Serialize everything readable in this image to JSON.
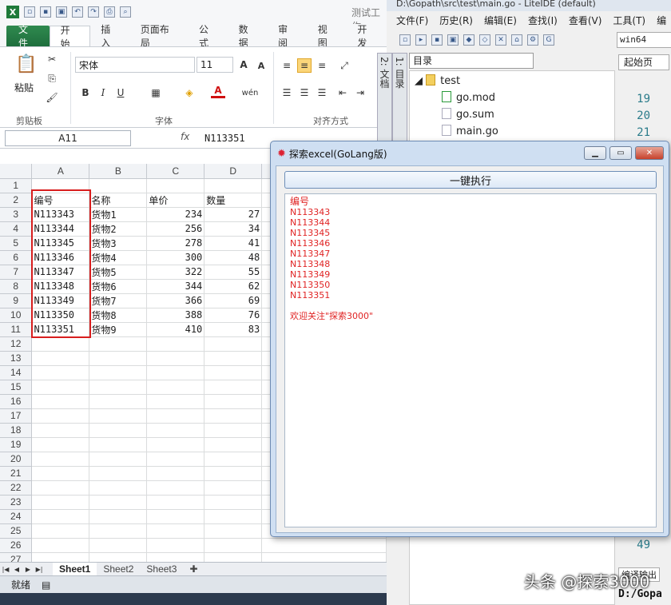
{
  "excel": {
    "workbook_title": "测试工作",
    "tabs": [
      "文件",
      "开始",
      "插入",
      "页面布局",
      "公式",
      "数据",
      "审阅",
      "视图",
      "开发"
    ],
    "ribbon": {
      "paste_label": "粘贴",
      "clipboard_label": "剪贴板",
      "font_name": "宋体",
      "font_size": "11",
      "font_group_label": "字体",
      "align_group_label": "对齐方式"
    },
    "name_box": "A11",
    "fx_label": "fx",
    "formula_value": "N113351",
    "col_headers": [
      "A",
      "B",
      "C",
      "D"
    ],
    "rows": [
      [
        "",
        "",
        "",
        ""
      ],
      [
        "编号",
        "名称",
        "单价",
        "数量"
      ],
      [
        "N113343",
        "货物1",
        "234",
        "27"
      ],
      [
        "N113344",
        "货物2",
        "256",
        "34"
      ],
      [
        "N113345",
        "货物3",
        "278",
        "41"
      ],
      [
        "N113346",
        "货物4",
        "300",
        "48"
      ],
      [
        "N113347",
        "货物5",
        "322",
        "55"
      ],
      [
        "N113348",
        "货物6",
        "344",
        "62"
      ],
      [
        "N113349",
        "货物7",
        "366",
        "69"
      ],
      [
        "N113350",
        "货物8",
        "388",
        "76"
      ],
      [
        "N113351",
        "货物9",
        "410",
        "83"
      ]
    ],
    "empty_row_count": 16,
    "sheets": [
      "Sheet1",
      "Sheet2",
      "Sheet3"
    ],
    "status": "就绪"
  },
  "ide": {
    "title": "D:\\Gopath\\src\\test\\main.go - LiteIDE (default)",
    "menu": [
      "文件(F)",
      "历史(R)",
      "编辑(E)",
      "查找(I)",
      "查看(V)",
      "工具(T)",
      "编"
    ],
    "target": "win64",
    "side_tabs": [
      "1: 目录",
      "2: 文档"
    ],
    "dir_select": "目录",
    "tree": {
      "folder": "test",
      "files": [
        "go.mod",
        "go.sum",
        "main.go"
      ]
    },
    "editor_tab": "起始页",
    "line_numbers": [
      "19",
      "20",
      "21"
    ],
    "last_line": "49",
    "output_label": "编译输出",
    "output_path": "D:/Gopa"
  },
  "dialog": {
    "title": "探索excel(GoLang版)",
    "run_button": "一键执行",
    "output_header": "编号",
    "output_lines": [
      "N113343",
      "N113344",
      "N113345",
      "N113346",
      "N113347",
      "N113348",
      "N113349",
      "N113350",
      "N113351"
    ],
    "footer_text": "欢迎关注\"探索3000\"",
    "text_color": "#e02424"
  },
  "watermark": "头条 @探索3000"
}
